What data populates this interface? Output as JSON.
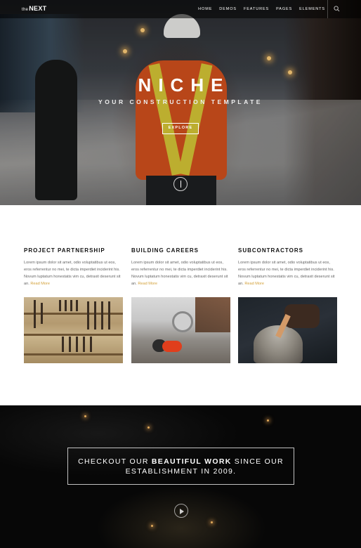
{
  "nav": {
    "logo_prefix": "the",
    "logo_main": "NEXT",
    "menu": [
      "HOME",
      "DEMOS",
      "FEATURES",
      "PAGES",
      "ELEMENTS"
    ],
    "search_icon": "search-icon"
  },
  "hero": {
    "title": "NICHE",
    "subtitle": "YOUR CONSTRUCTION TEMPLATE",
    "button_label": "EXPLORE",
    "scroll_icon": "arrow-down-circle-icon"
  },
  "features": [
    {
      "heading": "PROJECT PARTNERSHIP",
      "body": "Lorem ipsum dolor sit amet, odio voluptatibus ut eos, eros referrentur no mei, te dicta imperdiet inciderint his. Novum luptatum honestatis vim cu, detraxit deserunt sit an.",
      "link": "Read More"
    },
    {
      "heading": "BUILDING CAREERS",
      "body": "Lorem ipsum dolor sit amet, odio voluptatibus ut eos, eros referrentur no mei, te dicta imperdiet inciderint his. Novum luptatum honestatis vim cu, detraxit deserunt sit an.",
      "link": "Read More"
    },
    {
      "heading": "SUBCONTRACTORS",
      "body": "Lorem ipsum dolor sit amet, odio voluptatibus ut eos, eros referrentur no mei, te dicta imperdiet inciderint his. Novum luptatum honestatis vim cu, detraxit deserunt sit an.",
      "link": "Read More"
    }
  ],
  "cta": {
    "line1_pre": "CHECKOUT OUR ",
    "line1_bold": "BEAUTIFUL WORK",
    "line1_post": " SINCE OUR",
    "line2": "ESTABLISHMENT IN 2009.",
    "play_icon": "play-circle-icon"
  },
  "colors": {
    "accent": "#d3a13a",
    "dark": "#070707"
  }
}
